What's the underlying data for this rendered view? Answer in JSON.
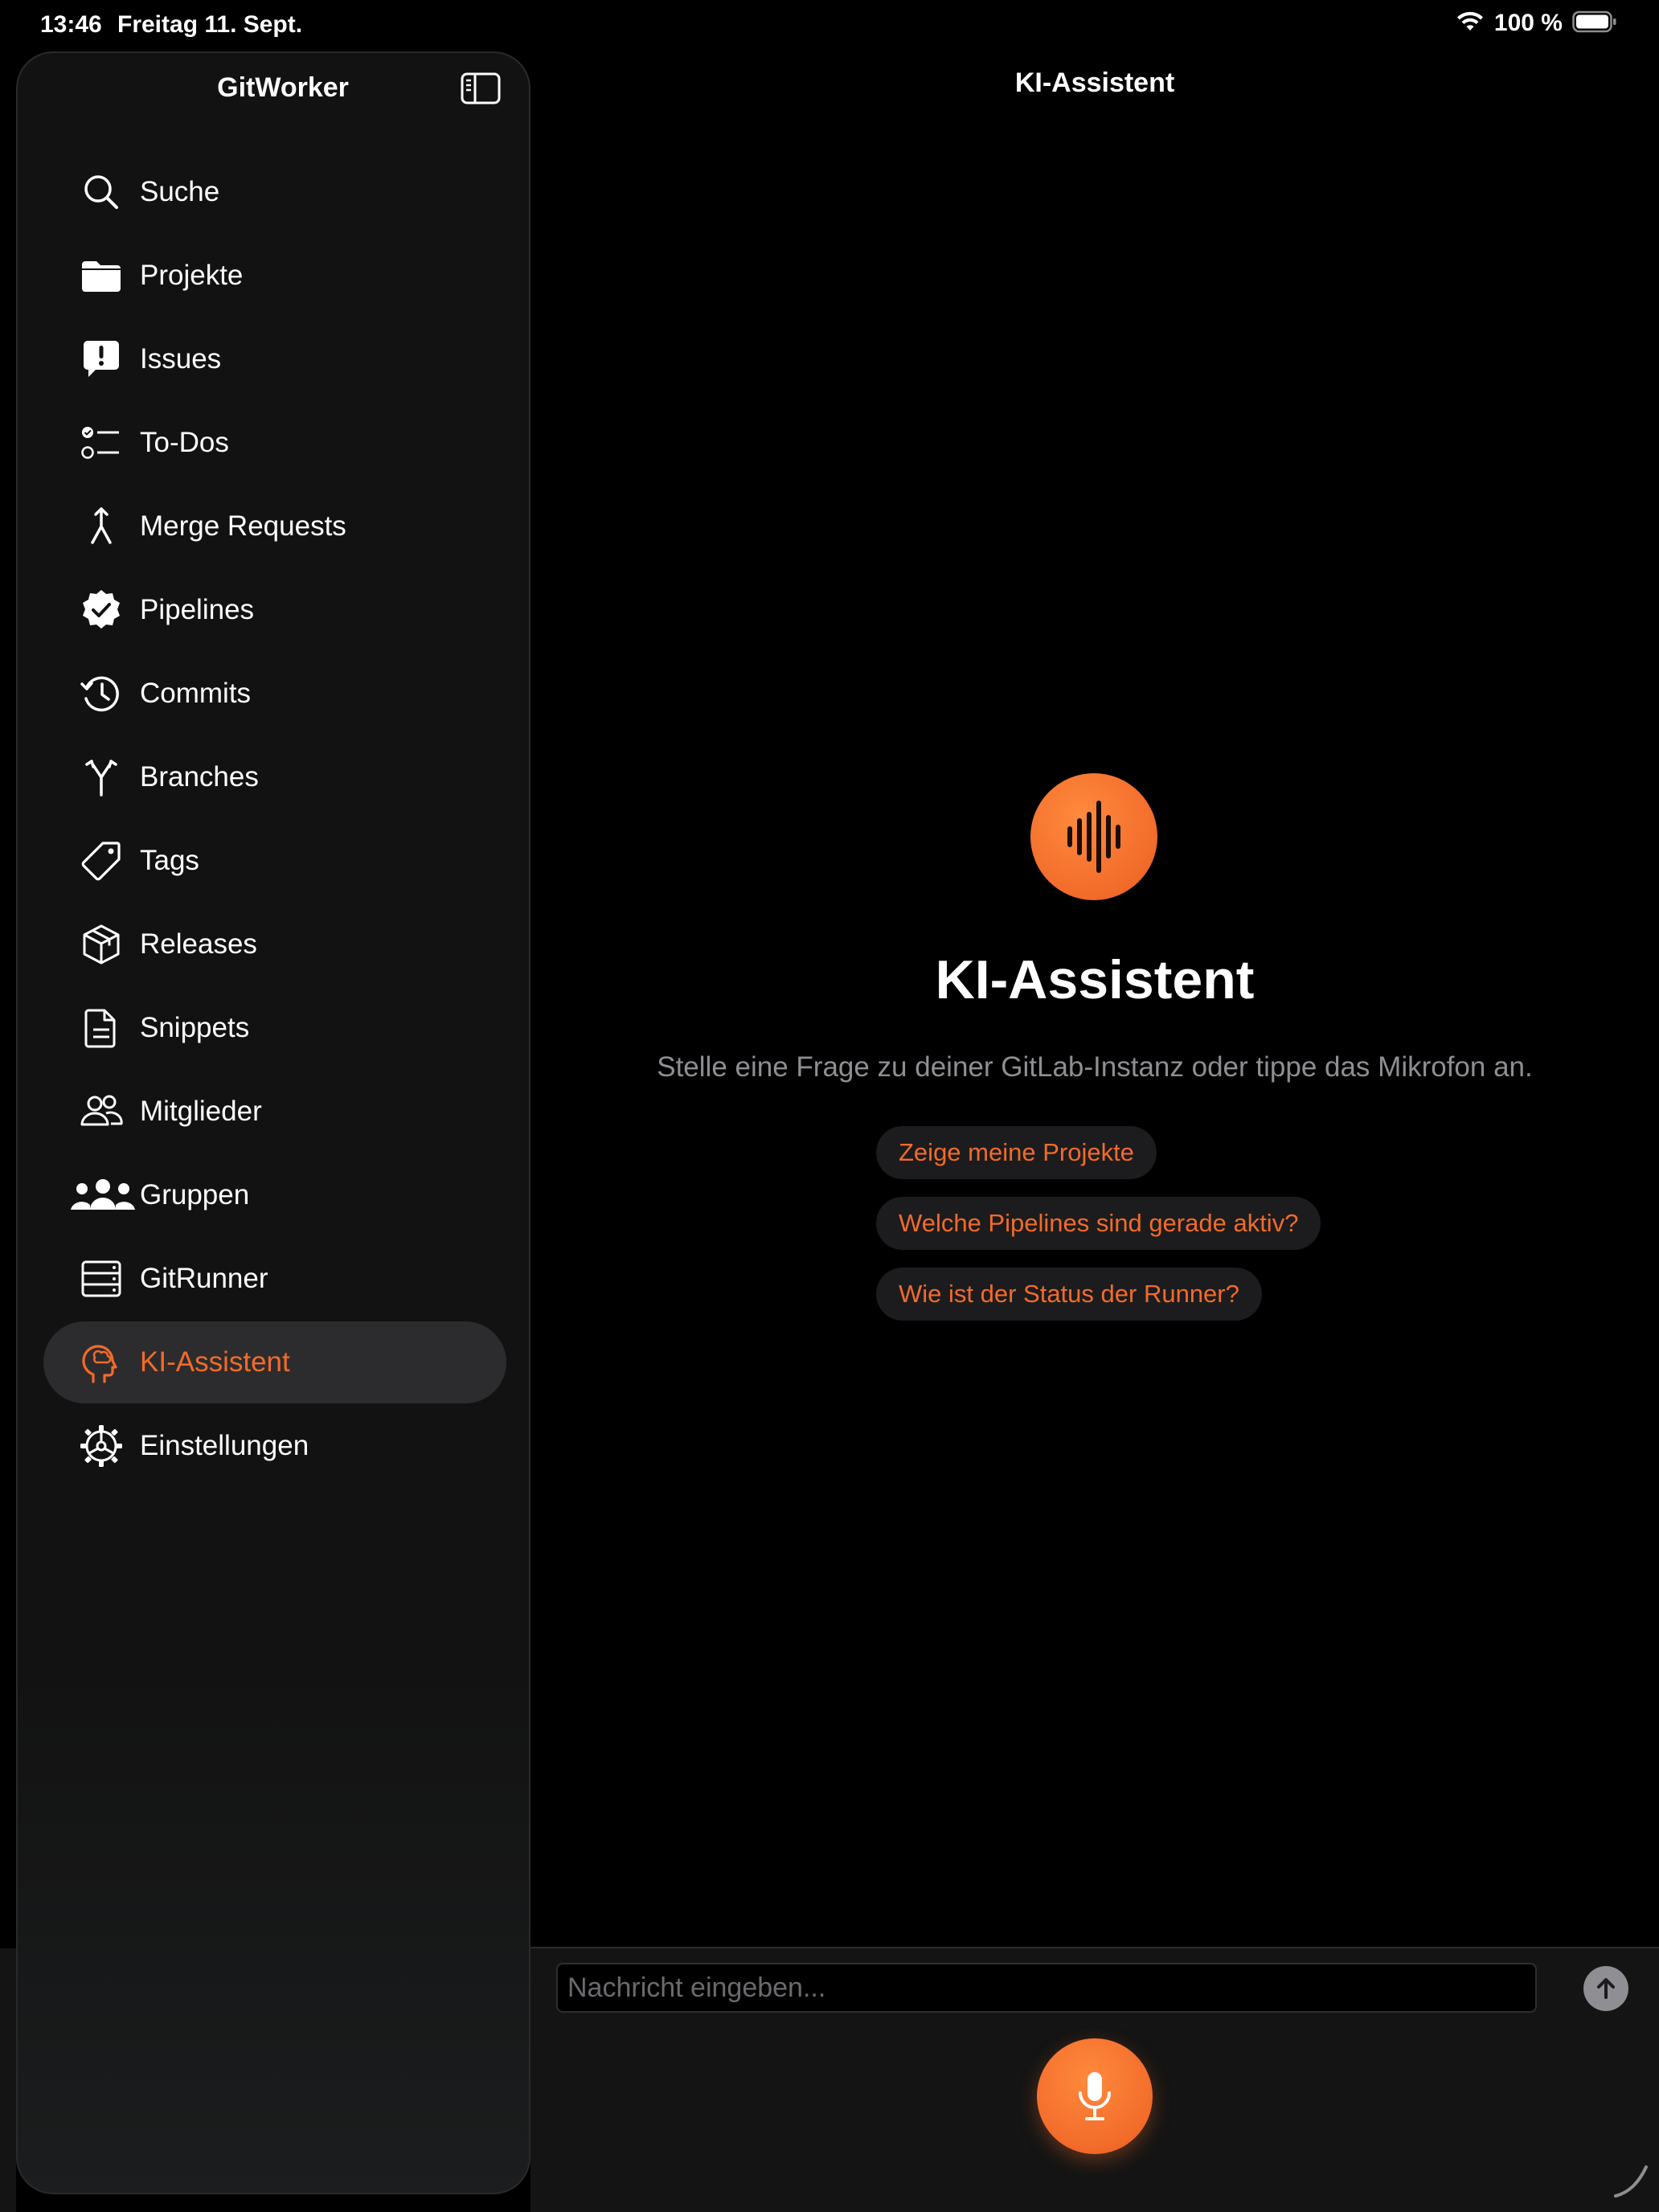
{
  "status_bar": {
    "time": "13:46",
    "date": "Freitag 11. Sept.",
    "battery_text": "100 %"
  },
  "sidebar": {
    "title": "GitWorker",
    "items": [
      {
        "label": "Suche",
        "icon": "search-icon"
      },
      {
        "label": "Projekte",
        "icon": "folder-icon"
      },
      {
        "label": "Issues",
        "icon": "issue-bubble-icon"
      },
      {
        "label": "To-Dos",
        "icon": "checklist-icon"
      },
      {
        "label": "Merge Requests",
        "icon": "merge-icon"
      },
      {
        "label": "Pipelines",
        "icon": "checkmark-seal-icon"
      },
      {
        "label": "Commits",
        "icon": "history-clock-icon"
      },
      {
        "label": "Branches",
        "icon": "branch-icon"
      },
      {
        "label": "Tags",
        "icon": "tag-icon"
      },
      {
        "label": "Releases",
        "icon": "package-icon"
      },
      {
        "label": "Snippets",
        "icon": "document-icon"
      },
      {
        "label": "Mitglieder",
        "icon": "two-people-icon"
      },
      {
        "label": "Gruppen",
        "icon": "group-people-icon"
      },
      {
        "label": "GitRunner",
        "icon": "server-icon"
      },
      {
        "label": "KI-Assistent",
        "icon": "brain-head-icon",
        "active": true
      },
      {
        "label": "Einstellungen",
        "icon": "gear-icon"
      }
    ]
  },
  "main": {
    "title": "KI-Assistent",
    "hero_title": "KI-Assistent",
    "hero_subtitle": "Stelle eine Frage zu deiner GitLab-Instanz oder tippe das Mikrofon an.",
    "suggestions": [
      "Zeige meine Projekte",
      "Welche Pipelines sind gerade aktiv?",
      "Wie ist der Status der Runner?"
    ]
  },
  "input_bar": {
    "placeholder": "Nachricht eingeben...",
    "value": ""
  },
  "colors": {
    "accent": "#f26b2a",
    "background": "#000000",
    "sidebar": "#121212",
    "muted_text": "#8e8e93",
    "chip_background": "#1c1c1e"
  }
}
